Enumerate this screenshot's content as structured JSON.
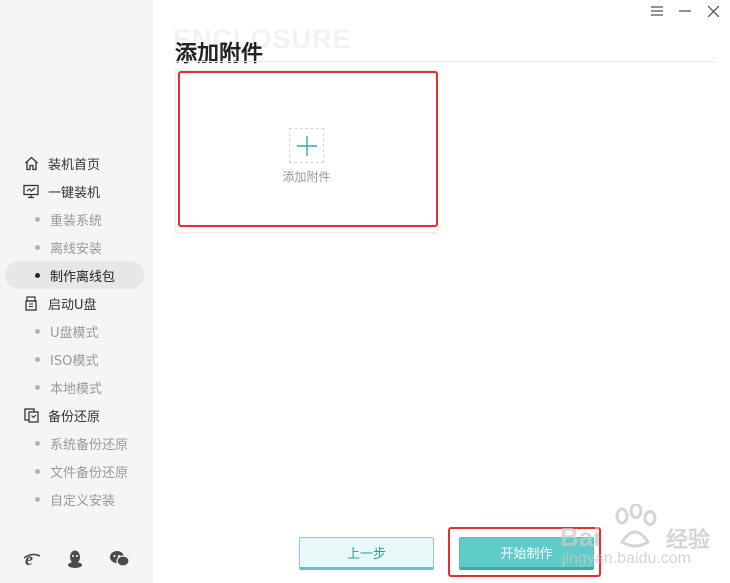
{
  "window": {
    "controls": [
      "menu-icon",
      "minimize-icon",
      "close-icon"
    ]
  },
  "sidebar": {
    "items": [
      {
        "type": "main",
        "label": "装机首页",
        "icon": "home-icon"
      },
      {
        "type": "main",
        "label": "一键装机",
        "icon": "monitor-icon"
      },
      {
        "type": "sub",
        "label": "重装系统"
      },
      {
        "type": "sub",
        "label": "离线安装"
      },
      {
        "type": "sub",
        "label": "制作离线包",
        "active": true
      },
      {
        "type": "main",
        "label": "启动U盘",
        "icon": "usb-icon"
      },
      {
        "type": "sub",
        "label": "U盘模式"
      },
      {
        "type": "sub",
        "label": "ISO模式"
      },
      {
        "type": "sub",
        "label": "本地模式"
      },
      {
        "type": "main",
        "label": "备份还原",
        "icon": "backup-icon"
      },
      {
        "type": "sub",
        "label": "系统备份还原"
      },
      {
        "type": "sub",
        "label": "文件备份还原"
      },
      {
        "type": "sub",
        "label": "自定义安装"
      }
    ],
    "bottom_icons": [
      "ie-browser-icon",
      "qq-icon",
      "wechat-icon"
    ]
  },
  "main": {
    "watermark_text": "ENCLOSURE",
    "title": "添加附件",
    "attach_card": {
      "label": "添加附件",
      "icon": "plus-icon"
    }
  },
  "footer": {
    "prev_label": "上一步",
    "start_label": "开始制作"
  },
  "baidu_watermark": {
    "brand": "Bai",
    "jy": "经验",
    "url": "jingyan.baidu.com"
  },
  "colors": {
    "accent": "#5ecdc9",
    "highlight": "#e52e2e",
    "sidebar_bg": "#f4f5f7"
  }
}
